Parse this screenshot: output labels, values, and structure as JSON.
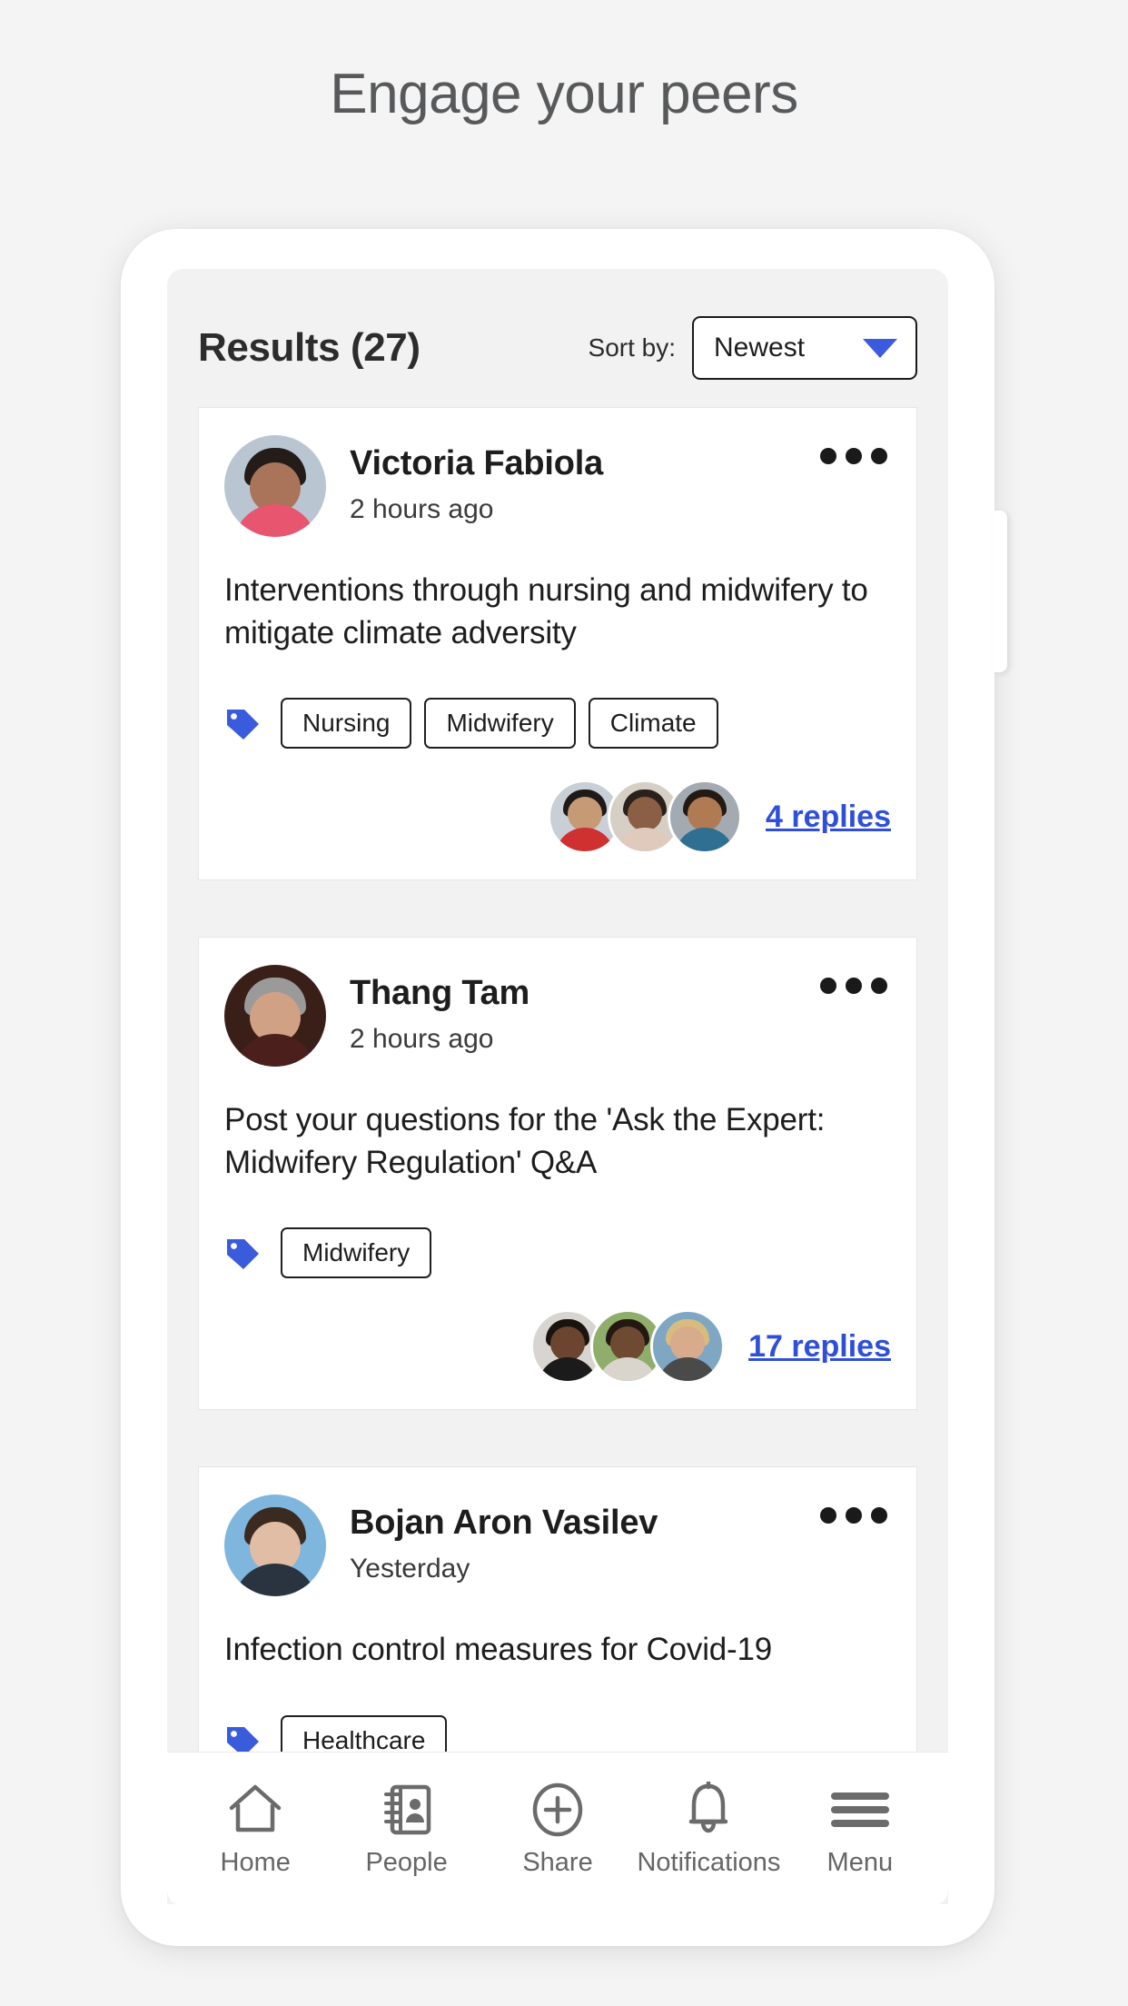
{
  "page": {
    "heading": "Engage your peers"
  },
  "header": {
    "results_title": "Results (27)",
    "sort_label": "Sort by:",
    "sort_value": "Newest",
    "sort_chevron_icon": "chevron-down-icon",
    "accent_color": "#3a5bdb"
  },
  "posts": [
    {
      "author": "Victoria Fabiola",
      "time": "2 hours ago",
      "body": "Interventions through nursing and midwifery to mitigate climate adversity",
      "tag_icon": "tag-icon",
      "tags": [
        "Nursing",
        "Midwifery",
        "Climate"
      ],
      "replies_label": "4 replies",
      "more_icon": "more-options-icon",
      "avatar_colors": {
        "bg": "#b9c6d2",
        "hair": "#241c18",
        "face": "#a9745a",
        "body": "#e8556f"
      },
      "reply_avatars": [
        {
          "bg": "#c9cfd6",
          "hair": "#1d1a18",
          "face": "#c79a76",
          "body": "#cf3030"
        },
        {
          "bg": "#d6cfc6",
          "hair": "#2b211c",
          "face": "#8a5f45",
          "body": "#e0c9bd"
        },
        {
          "bg": "#a3aab2",
          "hair": "#231a14",
          "face": "#b07b52",
          "body": "#2f6f92"
        }
      ]
    },
    {
      "author": "Thang Tam",
      "time": "2 hours ago",
      "body": "Post your questions for the 'Ask the Expert: Midwifery Regulation' Q&A",
      "tag_icon": "tag-icon",
      "tags": [
        "Midwifery"
      ],
      "replies_label": "17 replies",
      "more_icon": "more-options-icon",
      "avatar_colors": {
        "bg": "#3a1f18",
        "hair": "#9a9a9a",
        "face": "#d0a184",
        "body": "#4a1f1c"
      },
      "reply_avatars": [
        {
          "bg": "#d8d5d0",
          "hair": "#1a1310",
          "face": "#6b4530",
          "body": "#1b1b1b"
        },
        {
          "bg": "#8fae6c",
          "hair": "#241812",
          "face": "#6e4a32",
          "body": "#d9d4cc"
        },
        {
          "bg": "#7fa7c4",
          "hair": "#d9bb7e",
          "face": "#d8ab8c",
          "body": "#4a4a4a"
        }
      ]
    },
    {
      "author": "Bojan Aron Vasilev",
      "time": "Yesterday",
      "body": "Infection control measures for Covid-19",
      "tag_icon": "tag-icon",
      "tags": [
        "Healthcare"
      ],
      "replies_label": "",
      "more_icon": "more-options-icon",
      "avatar_colors": {
        "bg": "#7fb6de",
        "hair": "#3a2a20",
        "face": "#e0bda4",
        "body": "#2a3440"
      },
      "reply_avatars": []
    }
  ],
  "bottom_nav": [
    {
      "label": "Home",
      "icon": "home-icon"
    },
    {
      "label": "People",
      "icon": "contacts-book-icon"
    },
    {
      "label": "Share",
      "icon": "plus-circle-icon"
    },
    {
      "label": "Notifications",
      "icon": "bell-icon"
    },
    {
      "label": "Menu",
      "icon": "hamburger-menu-icon"
    }
  ]
}
